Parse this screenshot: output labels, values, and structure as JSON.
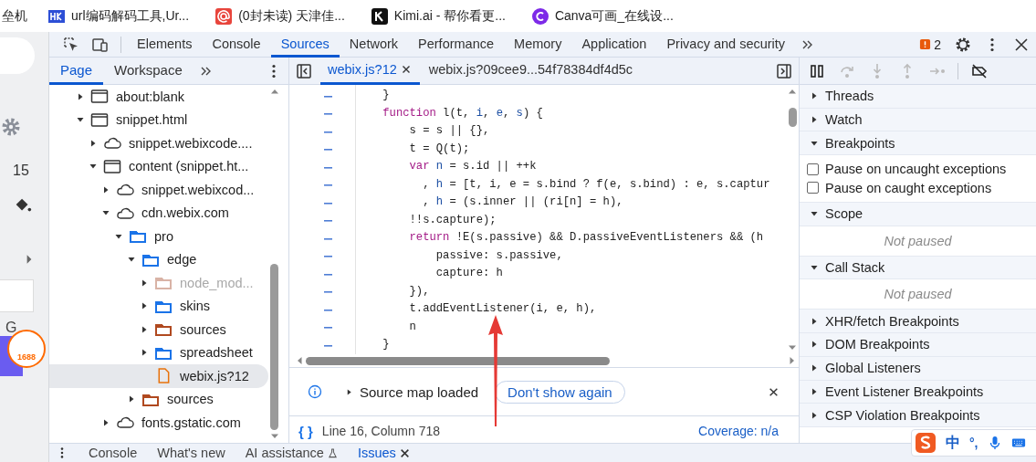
{
  "bookmarks": [
    {
      "label": "垒机",
      "kind": "none"
    },
    {
      "label": "url编码解码工具,Ur...",
      "kind": "hk"
    },
    {
      "label": "(0封未读) 天津佳...",
      "kind": "mail"
    },
    {
      "label": "Kimi.ai - 帮你看更...",
      "kind": "kimi"
    },
    {
      "label": "Canva可画_在线设...",
      "kind": "canva"
    }
  ],
  "page_behind": {
    "number": "15",
    "letter": "G",
    "logo_text": "1688"
  },
  "devtools": {
    "main_tabs": [
      {
        "label": "Elements",
        "selected": false
      },
      {
        "label": "Console",
        "selected": false
      },
      {
        "label": "Sources",
        "selected": true
      },
      {
        "label": "Network",
        "selected": false
      },
      {
        "label": "Performance",
        "selected": false
      },
      {
        "label": "Memory",
        "selected": false
      },
      {
        "label": "Application",
        "selected": false
      },
      {
        "label": "Privacy and security",
        "selected": false
      }
    ],
    "issues_count": "2",
    "navigator_tabs": [
      {
        "label": "Page",
        "selected": true
      },
      {
        "label": "Workspace",
        "selected": false
      }
    ],
    "tree": [
      {
        "label": "about:blank",
        "kind": "frame",
        "expanded": false,
        "selected": false,
        "dimmed": false
      },
      {
        "label": "snippet.html",
        "kind": "frame",
        "expanded": true,
        "selected": false,
        "dimmed": false,
        "children": [
          {
            "label": "snippet.webixcode....",
            "kind": "cloud",
            "expanded": false,
            "selected": false,
            "dimmed": false
          },
          {
            "label": "content (snippet.ht...",
            "kind": "frame",
            "expanded": true,
            "selected": false,
            "dimmed": false,
            "children": [
              {
                "label": "snippet.webixcod...",
                "kind": "cloud",
                "expanded": false,
                "selected": false,
                "dimmed": false
              },
              {
                "label": "cdn.webix.com",
                "kind": "cloud",
                "expanded": true,
                "selected": false,
                "dimmed": false,
                "children": [
                  {
                    "label": "pro",
                    "kind": "folder",
                    "color": "#1a73e8",
                    "expanded": true,
                    "selected": false,
                    "dimmed": false,
                    "children": [
                      {
                        "label": "edge",
                        "kind": "folder",
                        "color": "#1a73e8",
                        "expanded": true,
                        "selected": false,
                        "dimmed": false,
                        "children": [
                          {
                            "label": "node_mod...",
                            "kind": "folder",
                            "color": "#d9b3a6",
                            "expanded": false,
                            "selected": false,
                            "dimmed": true
                          },
                          {
                            "label": "skins",
                            "kind": "folder",
                            "color": "#1a73e8",
                            "expanded": false,
                            "selected": false,
                            "dimmed": false
                          },
                          {
                            "label": "sources",
                            "kind": "folder",
                            "color": "#b0491f",
                            "expanded": false,
                            "selected": false,
                            "dimmed": false
                          },
                          {
                            "label": "spreadsheet",
                            "kind": "folder",
                            "color": "#1a73e8",
                            "expanded": false,
                            "selected": false,
                            "dimmed": false
                          },
                          {
                            "label": "webix.js?12",
                            "kind": "file",
                            "selected": true,
                            "dimmed": false
                          }
                        ]
                      },
                      {
                        "label": "sources",
                        "kind": "folder",
                        "color": "#b0491f",
                        "expanded": false,
                        "selected": false,
                        "dimmed": false
                      }
                    ]
                  }
                ]
              },
              {
                "label": "fonts.gstatic.com",
                "kind": "cloud",
                "expanded": false,
                "selected": false,
                "dimmed": false
              }
            ]
          }
        ]
      }
    ],
    "editor_tabs": [
      {
        "label": "webix.js?12",
        "selected": true,
        "closable": true
      },
      {
        "label": "webix.js?09cee9...54f78384df4d5c",
        "selected": false,
        "closable": false
      }
    ],
    "code_lines": [
      [
        {
          "text": "    }",
          "kind": "plain"
        }
      ],
      [
        {
          "text": "    function",
          "kind": "keyword"
        },
        {
          "text": " l(t, ",
          "kind": "plain"
        },
        {
          "text": "i",
          "kind": "variable"
        },
        {
          "text": ", ",
          "kind": "plain"
        },
        {
          "text": "e",
          "kind": "variable"
        },
        {
          "text": ", ",
          "kind": "plain"
        },
        {
          "text": "s",
          "kind": "variable"
        },
        {
          "text": ") {",
          "kind": "plain"
        }
      ],
      [
        {
          "text": "        s = s || {},",
          "kind": "plain"
        }
      ],
      [
        {
          "text": "        t = Q(t);",
          "kind": "plain"
        }
      ],
      [
        {
          "text": "        var ",
          "kind": "keyword"
        },
        {
          "text": "n",
          "kind": "variable"
        },
        {
          "text": " = s.id || ++k",
          "kind": "plain"
        }
      ],
      [
        {
          "text": "          , ",
          "kind": "plain"
        },
        {
          "text": "h",
          "kind": "variable"
        },
        {
          "text": " = [t, i, e = s.bind ? f(e, s.bind) : e, s.captur",
          "kind": "plain"
        }
      ],
      [
        {
          "text": "          , ",
          "kind": "plain"
        },
        {
          "text": "h",
          "kind": "variable"
        },
        {
          "text": " = (s.inner || (ri[n] = h),",
          "kind": "plain"
        }
      ],
      [
        {
          "text": "        !!s.capture);",
          "kind": "plain"
        }
      ],
      [
        {
          "text": "        return",
          "kind": "keyword"
        },
        {
          "text": " !E(s.passive) && D.passiveEventListeners && (h",
          "kind": "plain"
        }
      ],
      [
        {
          "text": "            passive: s.passive,",
          "kind": "plain"
        }
      ],
      [
        {
          "text": "            capture: h",
          "kind": "plain"
        }
      ],
      [
        {
          "text": "        }),",
          "kind": "plain"
        }
      ],
      [
        {
          "text": "        t.addEventListener(i, e, h),",
          "kind": "plain"
        }
      ],
      [
        {
          "text": "        n",
          "kind": "plain"
        }
      ],
      [
        {
          "text": "    }",
          "kind": "plain"
        }
      ]
    ],
    "infobar": {
      "message": "Source map loaded",
      "button": "Don't show again"
    },
    "status": {
      "pretty_print": "{ }",
      "position": "Line 16, Column 718",
      "coverage": "Coverage: n/a"
    },
    "sidebar_sections": [
      {
        "title": "Threads",
        "expanded": false
      },
      {
        "title": "Watch",
        "expanded": false
      },
      {
        "title": "Breakpoints",
        "expanded": true,
        "kind": "checks",
        "items": [
          {
            "label": "Pause on uncaught exceptions",
            "checked": false
          },
          {
            "label": "Pause on caught exceptions",
            "checked": false
          }
        ]
      },
      {
        "title": "Scope",
        "expanded": true,
        "kind": "message",
        "message": "Not paused"
      },
      {
        "title": "Call Stack",
        "expanded": true,
        "kind": "message",
        "message": "Not paused"
      },
      {
        "title": "XHR/fetch Breakpoints",
        "expanded": false
      },
      {
        "title": "DOM Breakpoints",
        "expanded": false
      },
      {
        "title": "Global Listeners",
        "expanded": false
      },
      {
        "title": "Event Listener Breakpoints",
        "expanded": false
      },
      {
        "title": "CSP Violation Breakpoints",
        "expanded": false
      }
    ],
    "drawer_tabs": [
      {
        "label": "Console",
        "selected": false,
        "kind": "plain"
      },
      {
        "label": "What's new",
        "selected": false,
        "kind": "plain"
      },
      {
        "label": "AI assistance",
        "selected": false,
        "kind": "experimental"
      },
      {
        "label": "Issues",
        "selected": true,
        "kind": "closable"
      }
    ]
  },
  "ime": {
    "mode": "中",
    "punct": "°,"
  }
}
